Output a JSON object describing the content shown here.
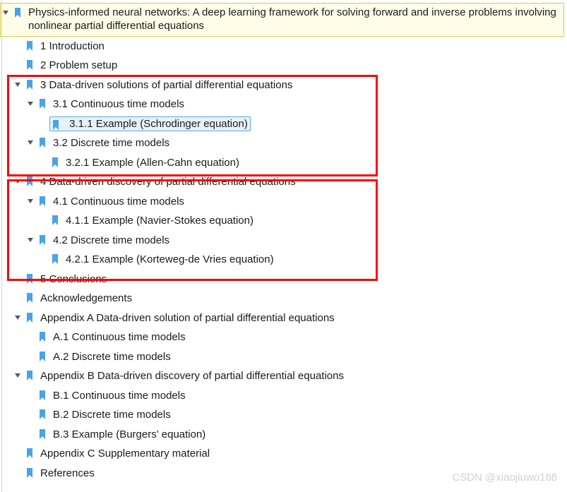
{
  "root": {
    "title": "Physics-informed neural networks: A deep learning framework for solving forward and inverse problems involving nonlinear partial differential equations"
  },
  "items": {
    "intro": "1 Introduction",
    "problem": "2 Problem setup",
    "sec3": "3 Data-driven solutions of partial differential equations",
    "sec31": "3.1 Continuous time models",
    "sec311": "3.1.1 Example (Schrodinger equation)",
    "sec32": "3.2 Discrete time models",
    "sec321": "3.2.1 Example (Allen-Cahn equation)",
    "sec4": "4 Data-driven discovery of partial differential equations",
    "sec41": "4.1 Continuous time models",
    "sec411": "4.1.1 Example (Navier-Stokes equation)",
    "sec42": "4.2 Discrete time models",
    "sec421": "4.2.1 Example (Korteweg-de Vries equation)",
    "sec5": "5 Conclusions",
    "ack": "Acknowledgements",
    "appA": "Appendix A Data-driven solution of partial differential equations",
    "appA1": "A.1 Continuous time models",
    "appA2": "A.2 Discrete time models",
    "appB": "Appendix B Data-driven discovery of partial differential equations",
    "appB1": "B.1 Continuous time models",
    "appB2": "B.2 Discrete time models",
    "appB3": "B.3 Example (Burgers' equation)",
    "appC": "Appendix C Supplementary material",
    "refs": "References"
  },
  "watermark": "CSDN @xiaojiuwo168"
}
